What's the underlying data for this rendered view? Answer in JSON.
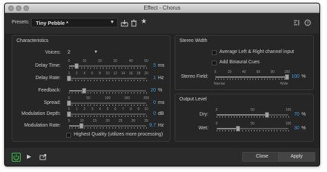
{
  "window": {
    "title": "Effect - Chorus"
  },
  "presets": {
    "label": "Presets:",
    "value": "Tiny Pebble *"
  },
  "characteristics": {
    "title": "Characteristics",
    "voices": {
      "label": "Voices:",
      "value": "2"
    },
    "sliders": [
      {
        "label": "Delay Time:",
        "value": "5",
        "unit": "ms",
        "ticks": [
          "0",
          "10",
          "20",
          "30",
          "40",
          "50"
        ],
        "level": 0.1
      },
      {
        "label": "Delay Rate:",
        "value": "1",
        "unit": "Hz",
        "ticks": [
          "1",
          "2",
          "4",
          "6",
          "8",
          "10",
          "12",
          "14",
          "16",
          "18",
          "20"
        ],
        "level": 0.0
      },
      {
        "label": "Feedback:",
        "value": "20",
        "unit": "%",
        "ticks": [],
        "level": 0.2
      },
      {
        "label": "Spread:",
        "value": "0",
        "unit": "ms",
        "ticks": [
          "0",
          "50",
          "100",
          "150",
          "200"
        ],
        "level": 0.0
      },
      {
        "label": "Modulation Depth:",
        "value": "0",
        "unit": "dB",
        "ticks": [
          "0",
          "1",
          "2",
          "3",
          "4",
          "5",
          "6",
          "7",
          "8",
          "9",
          "10"
        ],
        "level": 0.0
      },
      {
        "label": "Modulation Rate:",
        "value": "9.7",
        "unit": "Hz",
        "ticks": [
          "5",
          "10",
          "15",
          "20",
          "25",
          "30",
          "35"
        ],
        "level": 0.16
      }
    ],
    "highest_quality": "Highest Quality (utilizes more processing)"
  },
  "stereo_width": {
    "title": "Stereo Width",
    "average_lr": "Average Left & Right channel input",
    "binaural": "Add Binaural Cues",
    "field": {
      "label": "Stereo Field:",
      "value": "100",
      "unit": "%",
      "ticks": [
        "0",
        "20",
        "40",
        "60",
        "80",
        "100"
      ],
      "level": 1.0,
      "left_label": "Narrow",
      "right_label": "Wide"
    }
  },
  "output_level": {
    "title": "Output Level",
    "sliders": [
      {
        "label": "Dry:",
        "value": "70",
        "unit": "%",
        "ticks": [
          "0",
          "50",
          "100"
        ],
        "level": 0.7
      },
      {
        "label": "Wet:",
        "value": "30",
        "unit": "%",
        "ticks": [
          "0",
          "50",
          "100"
        ],
        "level": 0.3
      }
    ]
  },
  "footer": {
    "close": "Close",
    "apply": "Apply"
  },
  "colors": {
    "accent": "#3fa0ee",
    "power": "#35c84a",
    "panel": "#262626"
  }
}
